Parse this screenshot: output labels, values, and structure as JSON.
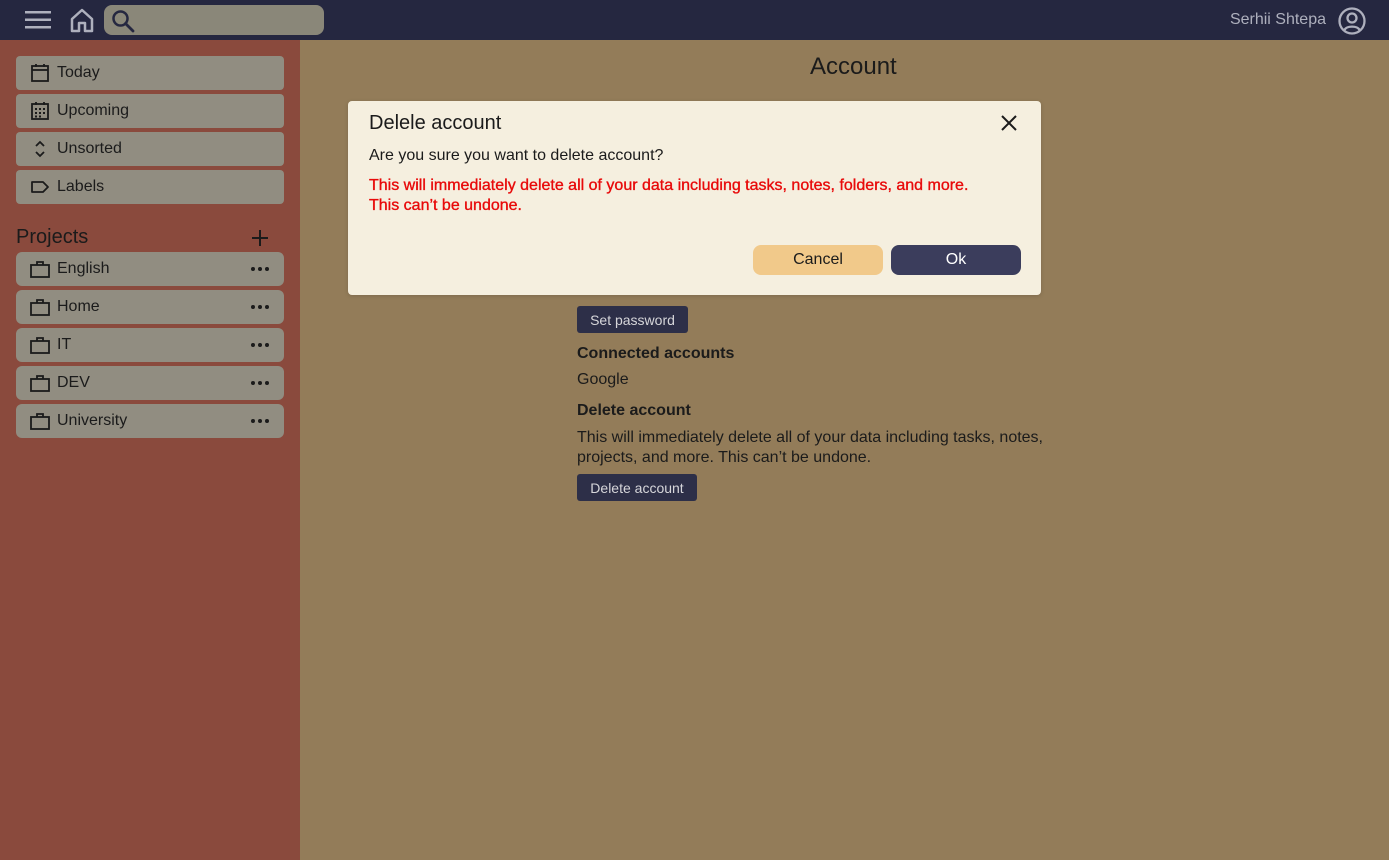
{
  "header": {
    "search_placeholder": "",
    "user_name": "Serhii Shtepa"
  },
  "sidebar": {
    "nav": [
      {
        "label": "Today",
        "icon": "calendar-icon"
      },
      {
        "label": "Upcoming",
        "icon": "calendar-grid-icon"
      },
      {
        "label": "Unsorted",
        "icon": "sort-icon"
      },
      {
        "label": "Labels",
        "icon": "label-icon"
      }
    ],
    "projects_title": "Projects",
    "projects": [
      {
        "label": "English",
        "icon": "briefcase-icon"
      },
      {
        "label": "Home",
        "icon": "briefcase-icon"
      },
      {
        "label": "IT",
        "icon": "briefcase-icon"
      },
      {
        "label": "DEV",
        "icon": "briefcase-icon"
      },
      {
        "label": "University",
        "icon": "briefcase-icon"
      }
    ]
  },
  "main": {
    "title": "Account",
    "set_password_label": "Set password",
    "connected_accounts_label": "Connected accounts",
    "connected_accounts": [
      "Google"
    ],
    "delete_account_label": "Delete account",
    "delete_description_line1": "This will immediately delete all of your data including tasks, notes,",
    "delete_description_line2": "projects, and more. This can’t be undone.",
    "delete_account_button": "Delete account"
  },
  "modal": {
    "title": "Delele account",
    "question": "Are you sure you want to delete account?",
    "warning_line1": "This will immediately delete all of your data including tasks, notes, folders, and more.",
    "warning_line2": "This can’t be undone.",
    "cancel_label": "Cancel",
    "ok_label": "Ok"
  },
  "colors": {
    "topbar": "#252740",
    "sidebar": "#8a4a3d",
    "main_bg": "#937c59",
    "item_bg": "#918d81",
    "modal_bg": "#f5efdf",
    "warning": "#e80a0a",
    "cancel_bg": "#f1c98a",
    "ok_bg": "#3b3d5c"
  }
}
